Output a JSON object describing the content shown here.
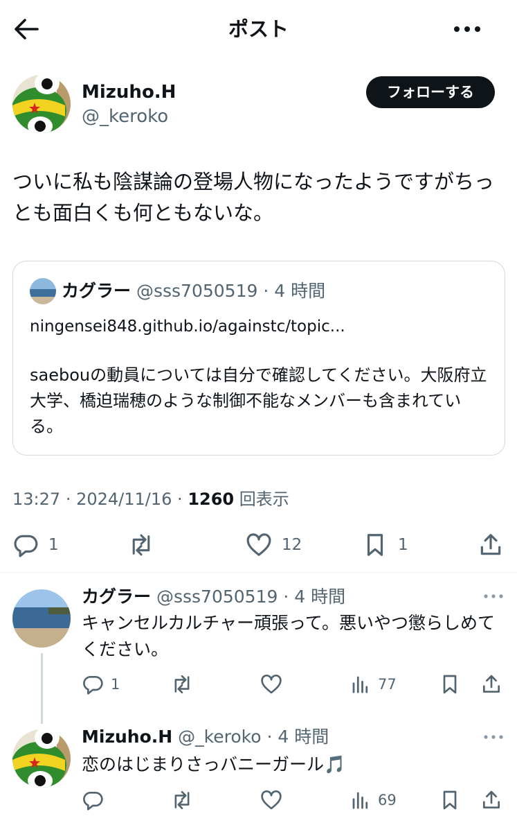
{
  "header": {
    "title": "ポスト",
    "back_icon": "arrow-left-icon",
    "more_icon": "more-dots-icon"
  },
  "post": {
    "author_name": "Mizuho.H",
    "author_handle": "@_keroko",
    "follow_label": "フォローする",
    "text": "ついに私も陰謀論の登場人物になったようですがちっとも面白くも何ともないな。",
    "quote": {
      "name": "カグラー",
      "handle": "@sss7050519",
      "time": "4 時間",
      "link": "ningensei848.github.io/againstc/topic...",
      "text": "saebouの動員については自分で確認してください。大阪府立大学、橋迫瑞穂のような制御不能なメンバーも含まれている。"
    },
    "time": "13:27",
    "date": "2024/11/16",
    "views": "1260",
    "views_label": "回表示",
    "stats": {
      "replies": "1",
      "reposts": "",
      "likes": "12",
      "bookmarks": "1"
    }
  },
  "replies": [
    {
      "name": "カグラー",
      "handle": "@sss7050519",
      "time": "4 時間",
      "text": "キャンセルカルチャー頑張って。悪いやつ懲らしめてください。",
      "stats": {
        "replies": "1",
        "views": "77"
      }
    },
    {
      "name": "Mizuho.H",
      "handle": "@_keroko",
      "time": "4 時間",
      "text": "恋のはじまりさっバニーガール🎵",
      "stats": {
        "replies": "",
        "views": "69"
      }
    }
  ],
  "colors": {
    "text": "#0f1419",
    "muted": "#536471",
    "border": "#cfd9de",
    "follow_bg": "#0f1419"
  }
}
